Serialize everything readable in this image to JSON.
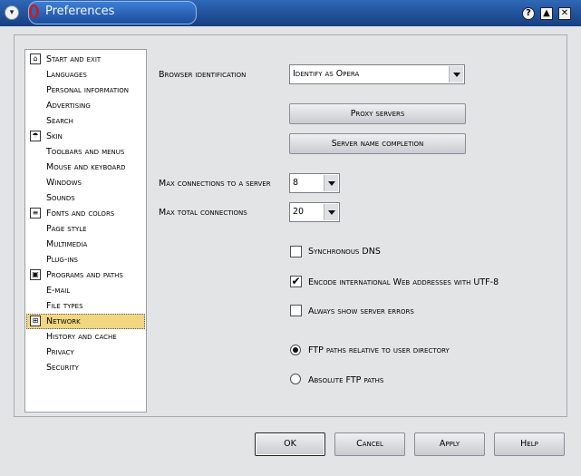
{
  "window": {
    "title": "Preferences",
    "menu_glyph": "▾",
    "help_glyph": "?",
    "shade_glyph": "▲",
    "close_glyph": "✕"
  },
  "sidebar": {
    "items": [
      {
        "label": "Start and exit",
        "icon": "door-icon",
        "glyph": "⌂"
      },
      {
        "label": "Languages"
      },
      {
        "label": "Personal information"
      },
      {
        "label": "Advertising"
      },
      {
        "label": "Search"
      },
      {
        "label": "Skin",
        "icon": "skin-icon",
        "glyph": "☂"
      },
      {
        "label": "Toolbars and menus"
      },
      {
        "label": "Mouse and keyboard"
      },
      {
        "label": "Windows"
      },
      {
        "label": "Sounds"
      },
      {
        "label": "Fonts and colors",
        "icon": "document-icon",
        "glyph": "≡"
      },
      {
        "label": "Page style"
      },
      {
        "label": "Multimedia"
      },
      {
        "label": "Plug-ins"
      },
      {
        "label": "Programs and paths",
        "icon": "disk-icon",
        "glyph": "▣"
      },
      {
        "label": "E-mail"
      },
      {
        "label": "File types"
      },
      {
        "label": "Network",
        "icon": "network-icon",
        "glyph": "⊞",
        "selected": true
      },
      {
        "label": "History and cache"
      },
      {
        "label": "Privacy"
      },
      {
        "label": "Security"
      }
    ]
  },
  "network": {
    "browser_id_label": "Browser identification",
    "browser_id_value": "Identify as Opera",
    "proxy_button": "Proxy servers",
    "server_name_button": "Server name completion",
    "max_per_server_label": "Max connections to a server",
    "max_per_server_value": "8",
    "max_total_label": "Max total connections",
    "max_total_value": "20",
    "sync_dns_label": "Synchronous DNS",
    "sync_dns_checked": false,
    "utf8_label": "Encode international Web addresses with UTF-8",
    "utf8_checked": true,
    "server_errors_label": "Always show server errors",
    "server_errors_checked": false,
    "ftp_relative_label": "FTP paths relative to user directory",
    "ftp_absolute_label": "Absolute FTP paths",
    "ftp_selected": "relative"
  },
  "footer": {
    "ok": "OK",
    "cancel": "Cancel",
    "apply": "Apply",
    "help": "Help"
  },
  "check_glyph": "✔"
}
